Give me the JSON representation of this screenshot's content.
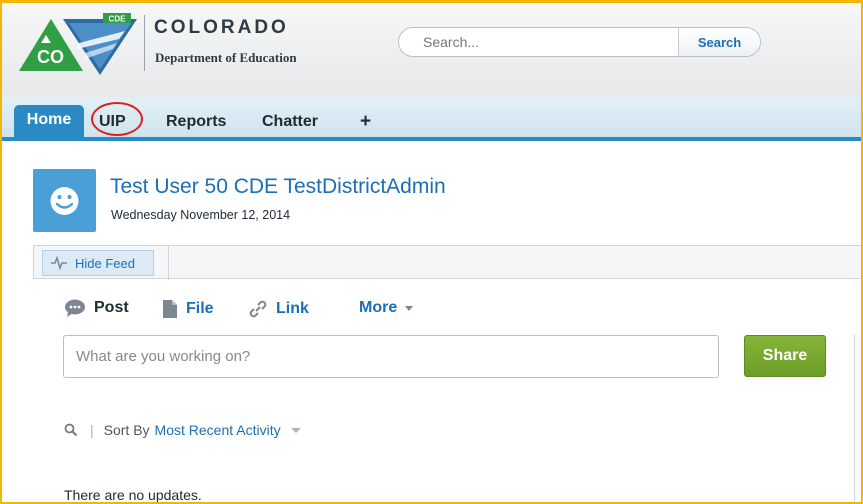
{
  "header": {
    "logo_badge_text": "CDE",
    "logo_short": "CO",
    "org_name": "COLORADO",
    "org_sub": "Department of Education",
    "search_placeholder": "Search...",
    "search_button": "Search"
  },
  "tabs": [
    {
      "label": "Home",
      "active": true
    },
    {
      "label": "UIP",
      "highlighted": true
    },
    {
      "label": "Reports"
    },
    {
      "label": "Chatter"
    },
    {
      "label": "+",
      "icon": "plus-icon"
    }
  ],
  "profile": {
    "name": "Test User 50 CDE TestDistrictAdmin",
    "date": "Wednesday November 12, 2014",
    "avatar_icon": "smiley-face-icon"
  },
  "feed": {
    "hide_feed_label": "Hide Feed",
    "actions": {
      "post": "Post",
      "file": "File",
      "link": "Link",
      "more": "More"
    },
    "publisher_placeholder": "What are you working on?",
    "share_label": "Share",
    "sort_by_label": "Sort By",
    "sort_value": "Most Recent Activity",
    "empty_message": "There are no updates."
  },
  "colors": {
    "accent_blue": "#2a8bc4",
    "link_blue": "#1b6fb5",
    "share_green": "#7aab2e",
    "highlight_ring": "#d92020",
    "frame_border": "#f2b705"
  }
}
